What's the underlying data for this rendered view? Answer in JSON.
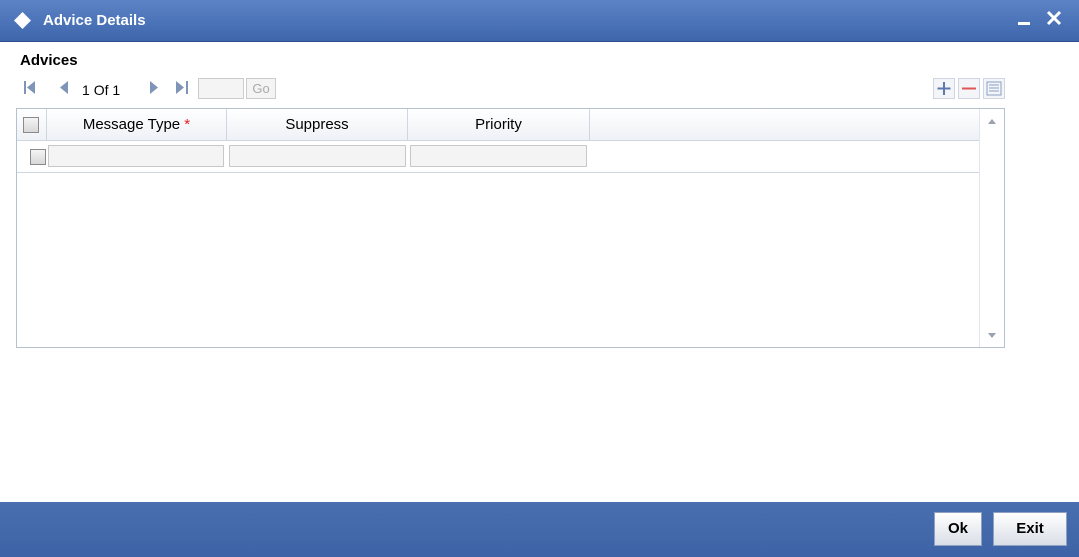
{
  "window": {
    "title": "Advice Details",
    "icon": "diamond-icon",
    "controls": {
      "minimize": "minimize-icon",
      "close": "close-icon"
    }
  },
  "section": {
    "title": "Advices"
  },
  "pagination": {
    "current": "1",
    "separator": "Of",
    "total": "1",
    "page_input_value": "",
    "go_label": "Go",
    "icons": [
      "first-page-icon",
      "prev-page-icon",
      "next-page-icon",
      "last-page-icon"
    ]
  },
  "grid_tools": {
    "icons": [
      "add-row-icon",
      "delete-row-icon",
      "single-view-icon"
    ]
  },
  "table": {
    "columns": [
      {
        "label": "Message Type",
        "required_marker": "*"
      },
      {
        "label": "Suppress"
      },
      {
        "label": "Priority"
      }
    ],
    "rows": [
      {
        "checked": false,
        "message_type": "",
        "suppress": "",
        "priority": ""
      }
    ]
  },
  "footer": {
    "ok_label": "Ok",
    "exit_label": "Exit"
  },
  "colors": {
    "titlebar": "#4a72b8",
    "footer": "#4568aa",
    "required": "#e21c1c"
  }
}
